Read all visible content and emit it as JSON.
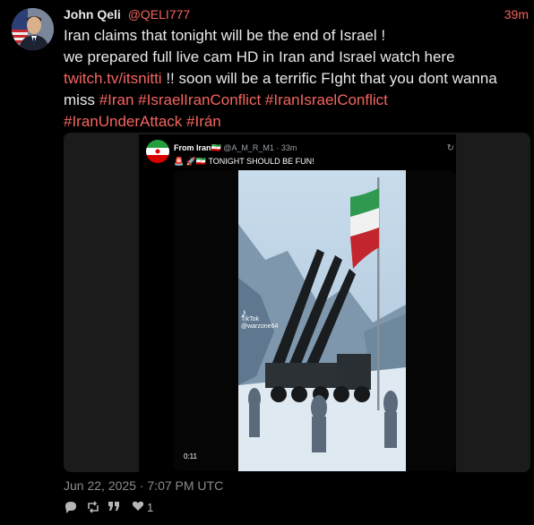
{
  "author": {
    "name": "John Qeli",
    "handle": "@QELI777",
    "time": "39m"
  },
  "text": {
    "line1": "Iran claims that tonight will be the end of Israel !",
    "line2": "we prepared full live cam HD in Iran and Israel watch here",
    "link": "twitch.tv/itsnitti",
    "line3_rest": " !! soon will be a terrific FIght that you dont wanna miss",
    "hashtags_a": "#Iran #IsraelIranConflict #IranIsraelConflict",
    "hashtags_b": "#IranUnderAttack #Irán"
  },
  "embed": {
    "from": "From Iran🇮🇷",
    "meta": "@A_M_R_M1 · 33m",
    "subtitle": "🚨 🚀🇮🇷 TONIGHT SHOULD BE FUN!",
    "tiktok_label": "TikTok",
    "tiktok_user": "@warzone64",
    "duration": "0:11"
  },
  "footer": {
    "date": "Jun 22, 2025 · 7:07 PM UTC",
    "likes": "1"
  },
  "colors": {
    "accent": "#f4645f",
    "background": "#000000"
  }
}
